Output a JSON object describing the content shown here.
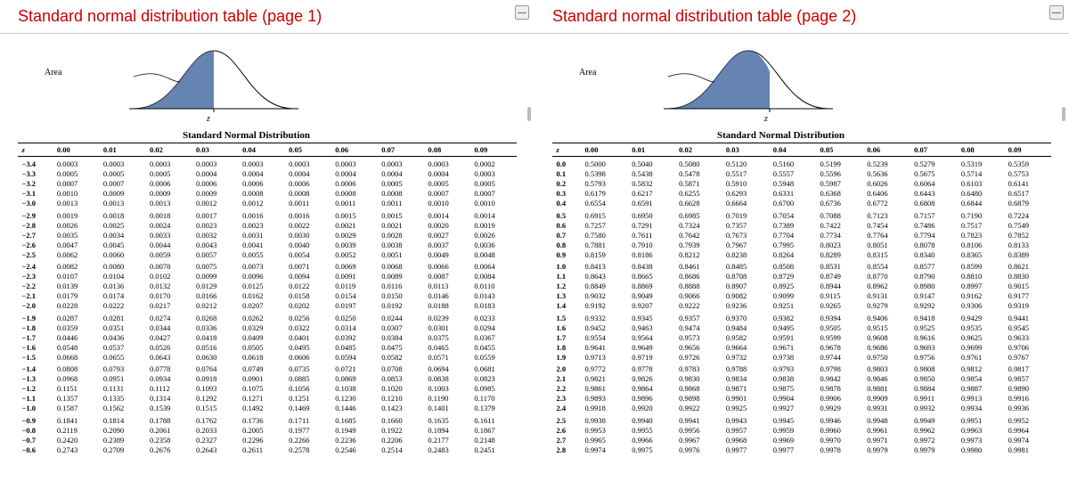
{
  "pages": [
    {
      "title": "Standard normal distribution table (page 1)",
      "tableTitle": "Standard Normal Distribution",
      "areaLabel": "Area",
      "zLabel": "z",
      "fillSide": "left"
    },
    {
      "title": "Standard normal distribution table (page 2)",
      "tableTitle": "Standard Normal Distribution",
      "areaLabel": "Area",
      "zLabel": "z",
      "fillSide": "right"
    }
  ],
  "headers": [
    "z",
    "0.00",
    "0.01",
    "0.02",
    "0.03",
    "0.04",
    "0.05",
    "0.06",
    "0.07",
    "0.08",
    "0.09"
  ],
  "page1_rows": [
    [
      "−3.4",
      "0.0003",
      "0.0003",
      "0.0003",
      "0.0003",
      "0.0003",
      "0.0003",
      "0.0003",
      "0.0003",
      "0.0003",
      "0.0002"
    ],
    [
      "−3.3",
      "0.0005",
      "0.0005",
      "0.0005",
      "0.0004",
      "0.0004",
      "0.0004",
      "0.0004",
      "0.0004",
      "0.0004",
      "0.0003"
    ],
    [
      "−3.2",
      "0.0007",
      "0.0007",
      "0.0006",
      "0.0006",
      "0.0006",
      "0.0006",
      "0.0006",
      "0.0005",
      "0.0005",
      "0.0005"
    ],
    [
      "−3.1",
      "0.0010",
      "0.0009",
      "0.0009",
      "0.0009",
      "0.0008",
      "0.0008",
      "0.0008",
      "0.0008",
      "0.0007",
      "0.0007"
    ],
    [
      "−3.0",
      "0.0013",
      "0.0013",
      "0.0013",
      "0.0012",
      "0.0012",
      "0.0011",
      "0.0011",
      "0.0011",
      "0.0010",
      "0.0010"
    ],
    [
      "−2.9",
      "0.0019",
      "0.0018",
      "0.0018",
      "0.0017",
      "0.0016",
      "0.0016",
      "0.0015",
      "0.0015",
      "0.0014",
      "0.0014"
    ],
    [
      "−2.8",
      "0.0026",
      "0.0025",
      "0.0024",
      "0.0023",
      "0.0023",
      "0.0022",
      "0.0021",
      "0.0021",
      "0.0020",
      "0.0019"
    ],
    [
      "−2.7",
      "0.0035",
      "0.0034",
      "0.0033",
      "0.0032",
      "0.0031",
      "0.0030",
      "0.0029",
      "0.0028",
      "0.0027",
      "0.0026"
    ],
    [
      "−2.6",
      "0.0047",
      "0.0045",
      "0.0044",
      "0.0043",
      "0.0041",
      "0.0040",
      "0.0039",
      "0.0038",
      "0.0037",
      "0.0036"
    ],
    [
      "−2.5",
      "0.0062",
      "0.0060",
      "0.0059",
      "0.0057",
      "0.0055",
      "0.0054",
      "0.0052",
      "0.0051",
      "0.0049",
      "0.0048"
    ],
    [
      "−2.4",
      "0.0082",
      "0.0080",
      "0.0078",
      "0.0075",
      "0.0073",
      "0.0071",
      "0.0069",
      "0.0068",
      "0.0066",
      "0.0064"
    ],
    [
      "−2.3",
      "0.0107",
      "0.0104",
      "0.0102",
      "0.0099",
      "0.0096",
      "0.0094",
      "0.0091",
      "0.0089",
      "0.0087",
      "0.0084"
    ],
    [
      "−2.2",
      "0.0139",
      "0.0136",
      "0.0132",
      "0.0129",
      "0.0125",
      "0.0122",
      "0.0119",
      "0.0116",
      "0.0113",
      "0.0110"
    ],
    [
      "−2.1",
      "0.0179",
      "0.0174",
      "0.0170",
      "0.0166",
      "0.0162",
      "0.0158",
      "0.0154",
      "0.0150",
      "0.0146",
      "0.0143"
    ],
    [
      "−2.0",
      "0.0228",
      "0.0222",
      "0.0217",
      "0.0212",
      "0.0207",
      "0.0202",
      "0.0197",
      "0.0192",
      "0.0188",
      "0.0183"
    ],
    [
      "−1.9",
      "0.0287",
      "0.0281",
      "0.0274",
      "0.0268",
      "0.0262",
      "0.0256",
      "0.0250",
      "0.0244",
      "0.0239",
      "0.0233"
    ],
    [
      "−1.8",
      "0.0359",
      "0.0351",
      "0.0344",
      "0.0336",
      "0.0329",
      "0.0322",
      "0.0314",
      "0.0307",
      "0.0301",
      "0.0294"
    ],
    [
      "−1.7",
      "0.0446",
      "0.0436",
      "0.0427",
      "0.0418",
      "0.0409",
      "0.0401",
      "0.0392",
      "0.0384",
      "0.0375",
      "0.0367"
    ],
    [
      "−1.6",
      "0.0548",
      "0.0537",
      "0.0526",
      "0.0516",
      "0.0505",
      "0.0495",
      "0.0485",
      "0.0475",
      "0.0465",
      "0.0455"
    ],
    [
      "−1.5",
      "0.0668",
      "0.0655",
      "0.0643",
      "0.0630",
      "0.0618",
      "0.0606",
      "0.0594",
      "0.0582",
      "0.0571",
      "0.0559"
    ],
    [
      "−1.4",
      "0.0808",
      "0.0793",
      "0.0778",
      "0.0764",
      "0.0749",
      "0.0735",
      "0.0721",
      "0.0708",
      "0.0694",
      "0.0681"
    ],
    [
      "−1.3",
      "0.0968",
      "0.0951",
      "0.0934",
      "0.0918",
      "0.0901",
      "0.0885",
      "0.0869",
      "0.0853",
      "0.0838",
      "0.0823"
    ],
    [
      "−1.2",
      "0.1151",
      "0.1131",
      "0.1112",
      "0.1093",
      "0.1075",
      "0.1056",
      "0.1038",
      "0.1020",
      "0.1003",
      "0.0985"
    ],
    [
      "−1.1",
      "0.1357",
      "0.1335",
      "0.1314",
      "0.1292",
      "0.1271",
      "0.1251",
      "0.1230",
      "0.1210",
      "0.1190",
      "0.1170"
    ],
    [
      "−1.0",
      "0.1587",
      "0.1562",
      "0.1539",
      "0.1515",
      "0.1492",
      "0.1469",
      "0.1446",
      "0.1423",
      "0.1401",
      "0.1379"
    ],
    [
      "−0.9",
      "0.1841",
      "0.1814",
      "0.1788",
      "0.1762",
      "0.1736",
      "0.1711",
      "0.1685",
      "0.1660",
      "0.1635",
      "0.1611"
    ],
    [
      "−0.8",
      "0.2119",
      "0.2090",
      "0.2061",
      "0.2033",
      "0.2005",
      "0.1977",
      "0.1949",
      "0.1922",
      "0.1894",
      "0.1867"
    ],
    [
      "−0.7",
      "0.2420",
      "0.2389",
      "0.2358",
      "0.2327",
      "0.2296",
      "0.2266",
      "0.2236",
      "0.2206",
      "0.2177",
      "0.2148"
    ],
    [
      "−0.6",
      "0.2743",
      "0.2709",
      "0.2676",
      "0.2643",
      "0.2611",
      "0.2578",
      "0.2546",
      "0.2514",
      "0.2483",
      "0.2451"
    ]
  ],
  "page2_rows": [
    [
      "0.0",
      "0.5000",
      "0.5040",
      "0.5080",
      "0.5120",
      "0.5160",
      "0.5199",
      "0.5239",
      "0.5279",
      "0.5319",
      "0.5359"
    ],
    [
      "0.1",
      "0.5398",
      "0.5438",
      "0.5478",
      "0.5517",
      "0.5557",
      "0.5596",
      "0.5636",
      "0.5675",
      "0.5714",
      "0.5753"
    ],
    [
      "0.2",
      "0.5793",
      "0.5832",
      "0.5871",
      "0.5910",
      "0.5948",
      "0.5987",
      "0.6026",
      "0.6064",
      "0.6103",
      "0.6141"
    ],
    [
      "0.3",
      "0.6179",
      "0.6217",
      "0.6255",
      "0.6293",
      "0.6331",
      "0.6368",
      "0.6406",
      "0.6443",
      "0.6480",
      "0.6517"
    ],
    [
      "0.4",
      "0.6554",
      "0.6591",
      "0.6628",
      "0.6664",
      "0.6700",
      "0.6736",
      "0.6772",
      "0.6808",
      "0.6844",
      "0.6879"
    ],
    [
      "0.5",
      "0.6915",
      "0.6950",
      "0.6985",
      "0.7019",
      "0.7054",
      "0.7088",
      "0.7123",
      "0.7157",
      "0.7190",
      "0.7224"
    ],
    [
      "0.6",
      "0.7257",
      "0.7291",
      "0.7324",
      "0.7357",
      "0.7389",
      "0.7422",
      "0.7454",
      "0.7486",
      "0.7517",
      "0.7549"
    ],
    [
      "0.7",
      "0.7580",
      "0.7611",
      "0.7642",
      "0.7673",
      "0.7704",
      "0.7734",
      "0.7764",
      "0.7794",
      "0.7823",
      "0.7852"
    ],
    [
      "0.8",
      "0.7881",
      "0.7910",
      "0.7939",
      "0.7967",
      "0.7995",
      "0.8023",
      "0.8051",
      "0.8078",
      "0.8106",
      "0.8133"
    ],
    [
      "0.9",
      "0.8159",
      "0.8186",
      "0.8212",
      "0.8238",
      "0.8264",
      "0.8289",
      "0.8315",
      "0.8340",
      "0.8365",
      "0.8389"
    ],
    [
      "1.0",
      "0.8413",
      "0.8438",
      "0.8461",
      "0.8485",
      "0.8508",
      "0.8531",
      "0.8554",
      "0.8577",
      "0.8599",
      "0.8621"
    ],
    [
      "1.1",
      "0.8643",
      "0.8665",
      "0.8686",
      "0.8708",
      "0.8729",
      "0.8749",
      "0.8770",
      "0.8790",
      "0.8810",
      "0.8830"
    ],
    [
      "1.2",
      "0.8849",
      "0.8869",
      "0.8888",
      "0.8907",
      "0.8925",
      "0.8944",
      "0.8962",
      "0.8980",
      "0.8997",
      "0.9015"
    ],
    [
      "1.3",
      "0.9032",
      "0.9049",
      "0.9066",
      "0.9082",
      "0.9099",
      "0.9115",
      "0.9131",
      "0.9147",
      "0.9162",
      "0.9177"
    ],
    [
      "1.4",
      "0.9192",
      "0.9207",
      "0.9222",
      "0.9236",
      "0.9251",
      "0.9265",
      "0.9279",
      "0.9292",
      "0.9306",
      "0.9319"
    ],
    [
      "1.5",
      "0.9332",
      "0.9345",
      "0.9357",
      "0.9370",
      "0.9382",
      "0.9394",
      "0.9406",
      "0.9418",
      "0.9429",
      "0.9441"
    ],
    [
      "1.6",
      "0.9452",
      "0.9463",
      "0.9474",
      "0.9484",
      "0.9495",
      "0.9505",
      "0.9515",
      "0.9525",
      "0.9535",
      "0.9545"
    ],
    [
      "1.7",
      "0.9554",
      "0.9564",
      "0.9573",
      "0.9582",
      "0.9591",
      "0.9599",
      "0.9608",
      "0.9616",
      "0.9625",
      "0.9633"
    ],
    [
      "1.8",
      "0.9641",
      "0.9649",
      "0.9656",
      "0.9664",
      "0.9671",
      "0.9678",
      "0.9686",
      "0.9693",
      "0.9699",
      "0.9706"
    ],
    [
      "1.9",
      "0.9713",
      "0.9719",
      "0.9726",
      "0.9732",
      "0.9738",
      "0.9744",
      "0.9750",
      "0.9756",
      "0.9761",
      "0.9767"
    ],
    [
      "2.0",
      "0.9772",
      "0.9778",
      "0.9783",
      "0.9788",
      "0.9793",
      "0.9798",
      "0.9803",
      "0.9808",
      "0.9812",
      "0.9817"
    ],
    [
      "2.1",
      "0.9821",
      "0.9826",
      "0.9830",
      "0.9834",
      "0.9838",
      "0.9842",
      "0.9846",
      "0.9850",
      "0.9854",
      "0.9857"
    ],
    [
      "2.2",
      "0.9861",
      "0.9864",
      "0.9868",
      "0.9871",
      "0.9875",
      "0.9878",
      "0.9881",
      "0.9884",
      "0.9887",
      "0.9890"
    ],
    [
      "2.3",
      "0.9893",
      "0.9896",
      "0.9898",
      "0.9901",
      "0.9904",
      "0.9906",
      "0.9909",
      "0.9911",
      "0.9913",
      "0.9916"
    ],
    [
      "2.4",
      "0.9918",
      "0.9920",
      "0.9922",
      "0.9925",
      "0.9927",
      "0.9929",
      "0.9931",
      "0.9932",
      "0.9934",
      "0.9936"
    ],
    [
      "2.5",
      "0.9938",
      "0.9940",
      "0.9941",
      "0.9943",
      "0.9945",
      "0.9946",
      "0.9948",
      "0.9949",
      "0.9951",
      "0.9952"
    ],
    [
      "2.6",
      "0.9953",
      "0.9955",
      "0.9956",
      "0.9957",
      "0.9959",
      "0.9960",
      "0.9961",
      "0.9962",
      "0.9963",
      "0.9964"
    ],
    [
      "2.7",
      "0.9965",
      "0.9966",
      "0.9967",
      "0.9968",
      "0.9969",
      "0.9970",
      "0.9971",
      "0.9972",
      "0.9973",
      "0.9974"
    ],
    [
      "2.8",
      "0.9974",
      "0.9975",
      "0.9976",
      "0.9977",
      "0.9977",
      "0.9978",
      "0.9979",
      "0.9979",
      "0.9980",
      "0.9981"
    ]
  ]
}
